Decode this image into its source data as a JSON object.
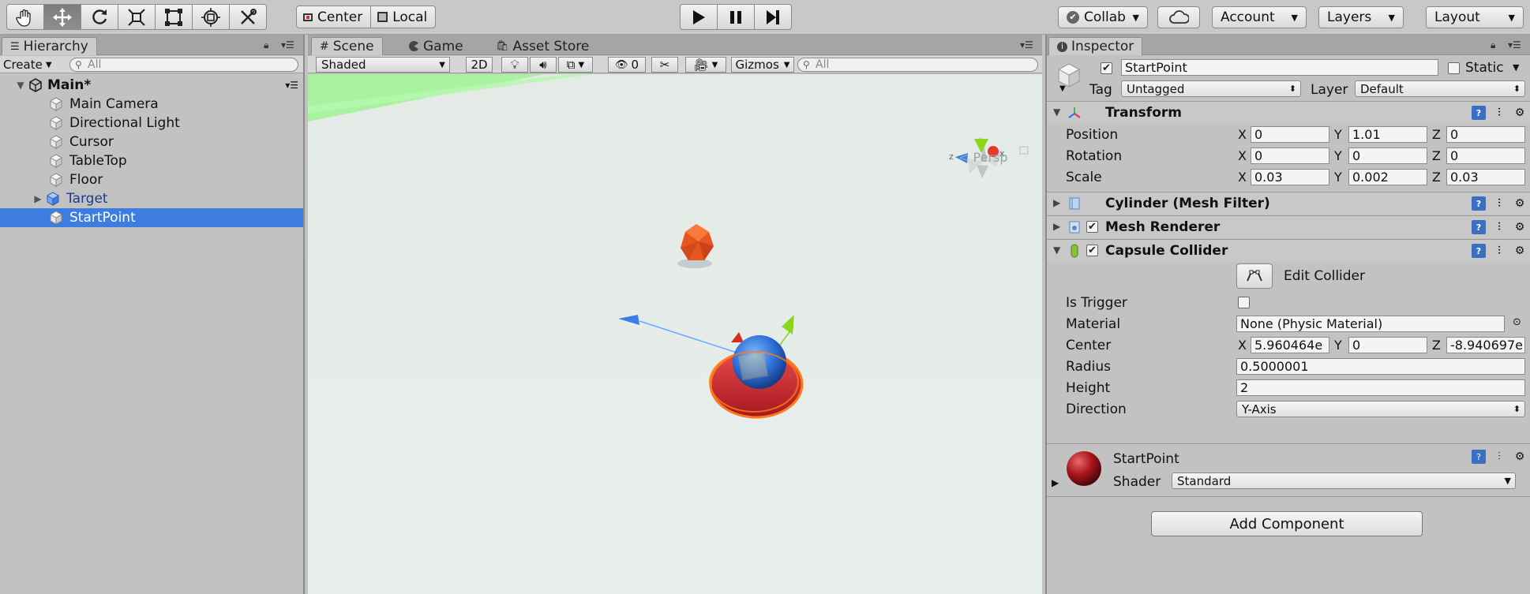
{
  "toolbar": {
    "tools": [
      "hand-tool-icon",
      "move-tool-icon",
      "rotate-tool-icon",
      "scale-tool-icon",
      "rect-tool-icon",
      "transform-tool-icon",
      "custom-tool-icon"
    ],
    "pivot_label": "Center",
    "space_label": "Local",
    "collab_label": "Collab",
    "account_label": "Account",
    "layers_label": "Layers",
    "layout_label": "Layout"
  },
  "hierarchy": {
    "tab_label": "Hierarchy",
    "create_label": "Create",
    "search_placeholder": "All",
    "scene_name": "Main*",
    "items": [
      {
        "label": "Main Camera"
      },
      {
        "label": "Directional Light"
      },
      {
        "label": "Cursor"
      },
      {
        "label": "TableTop"
      },
      {
        "label": "Floor"
      },
      {
        "label": "Target"
      },
      {
        "label": "StartPoint"
      }
    ]
  },
  "scene": {
    "tabs": [
      "Scene",
      "Game",
      "Asset Store"
    ],
    "draw_mode": "Shaded",
    "mode_2d": "2D",
    "hidden_count": "0",
    "gizmos_label": "Gizmos",
    "search_placeholder": "All",
    "persp_label": "< Persp",
    "gizmo_axes": {
      "x": "x",
      "z": "z"
    }
  },
  "inspector": {
    "tab_label": "Inspector",
    "object_name": "StartPoint",
    "static_label": "Static",
    "tag_label": "Tag",
    "tag_value": "Untagged",
    "layer_label": "Layer",
    "layer_value": "Default",
    "transform": {
      "title": "Transform",
      "position_label": "Position",
      "rotation_label": "Rotation",
      "scale_label": "Scale",
      "position": {
        "x": "0",
        "y": "1.01",
        "z": "0"
      },
      "rotation": {
        "x": "0",
        "y": "0",
        "z": "0"
      },
      "scale": {
        "x": "0.03",
        "y": "0.002",
        "z": "0.03"
      }
    },
    "mesh_filter_title": "Cylinder (Mesh Filter)",
    "mesh_renderer_title": "Mesh Renderer",
    "capsule": {
      "title": "Capsule Collider",
      "edit_label": "Edit Collider",
      "is_trigger_label": "Is Trigger",
      "material_label": "Material",
      "material_value": "None (Physic Material)",
      "center_label": "Center",
      "center": {
        "x": "5.960464e",
        "y": "0",
        "z": "-8.940697e"
      },
      "radius_label": "Radius",
      "radius_value": "0.5000001",
      "height_label": "Height",
      "height_value": "2",
      "direction_label": "Direction",
      "direction_value": "Y-Axis"
    },
    "material": {
      "name": "StartPoint",
      "shader_label": "Shader",
      "shader_value": "Standard"
    },
    "add_component_label": "Add Component"
  },
  "axis_labels": {
    "x": "X",
    "y": "Y",
    "z": "Z"
  },
  "colors": {
    "selection": "#3e7de0",
    "grid_green": "#a8f2a0",
    "target_orange": "#e8561f",
    "startpoint_red": "#c8282e",
    "gizmo_blue": "#3a7fe6",
    "gizmo_green": "#8ed31c"
  }
}
